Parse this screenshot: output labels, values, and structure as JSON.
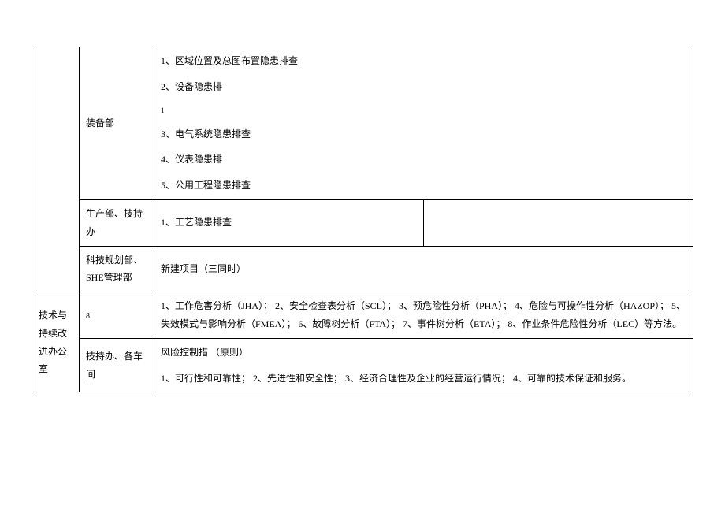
{
  "rows": {
    "equipment": {
      "dept": "装备部",
      "items": {
        "i1": "1、区域位置及总图布置隐患排查",
        "i2": "2、设备隐患排",
        "note": "1",
        "i3": "3、电气系统隐患排查",
        "i4": "4、仪表隐患排",
        "i5": "5、公用工程隐患排查"
      }
    },
    "production": {
      "dept": "生产部、技持办",
      "content": "1、工艺隐患排查"
    },
    "tech_plan": {
      "dept": "科技规划部、SHE管理部",
      "content": "新建项目（三同时）"
    },
    "tech_improve": {
      "left": "技术与持续改进办公室",
      "left_note": "8",
      "methods": "1、工作危害分析（JHA）；  2、安全检查表分析（SCL）；  3、预危险性分析（PHA）；  4、危险与可操作性分析（HAZOP）；  5、失效模式与影响分析（FMEA）；  6、故障树分析（FTA）；  7、事件树分析（ETA）；  8、作业条件危险性分析（LEC）等方法。",
      "dept2": "技持办、各车间",
      "title": "风险控制措 （原则）",
      "principles": "1、可行性和可靠性；  2、先进性和安全性；  3、经济合理性及企业的经营运行情况；  4、可靠的技术保证和服务。"
    }
  }
}
